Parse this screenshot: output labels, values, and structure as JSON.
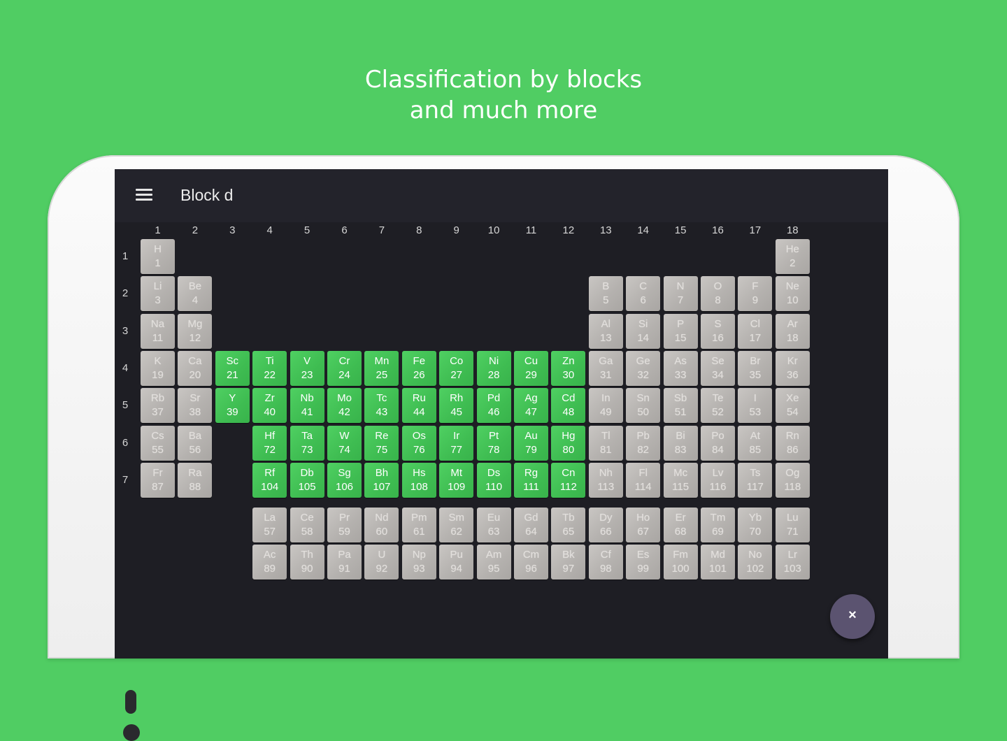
{
  "headline": {
    "line1": "Classification by blocks",
    "line2": "and much more"
  },
  "app": {
    "title": "Block d",
    "menu_icon": "hamburger-menu-icon",
    "fab_icon": "close-icon",
    "fab_symbol": "×"
  },
  "colors": {
    "background": "#50cd63",
    "screen": "#1e1e24",
    "toolbar": "#23232b",
    "block_d": "#42c155",
    "other": "#b9b6b3",
    "fab": "#5b5370"
  },
  "groups": [
    "1",
    "2",
    "3",
    "4",
    "5",
    "6",
    "7",
    "8",
    "9",
    "10",
    "11",
    "12",
    "13",
    "14",
    "15",
    "16",
    "17",
    "18"
  ],
  "periods": [
    "1",
    "2",
    "3",
    "4",
    "5",
    "6",
    "7"
  ],
  "elements": [
    {
      "sym": "H",
      "num": "1",
      "row": 1,
      "col": 1,
      "block": "s"
    },
    {
      "sym": "He",
      "num": "2",
      "row": 1,
      "col": 18,
      "block": "s"
    },
    {
      "sym": "Li",
      "num": "3",
      "row": 2,
      "col": 1,
      "block": "s"
    },
    {
      "sym": "Be",
      "num": "4",
      "row": 2,
      "col": 2,
      "block": "s"
    },
    {
      "sym": "B",
      "num": "5",
      "row": 2,
      "col": 13,
      "block": "p"
    },
    {
      "sym": "C",
      "num": "6",
      "row": 2,
      "col": 14,
      "block": "p"
    },
    {
      "sym": "N",
      "num": "7",
      "row": 2,
      "col": 15,
      "block": "p"
    },
    {
      "sym": "O",
      "num": "8",
      "row": 2,
      "col": 16,
      "block": "p"
    },
    {
      "sym": "F",
      "num": "9",
      "row": 2,
      "col": 17,
      "block": "p"
    },
    {
      "sym": "Ne",
      "num": "10",
      "row": 2,
      "col": 18,
      "block": "p"
    },
    {
      "sym": "Na",
      "num": "11",
      "row": 3,
      "col": 1,
      "block": "s"
    },
    {
      "sym": "Mg",
      "num": "12",
      "row": 3,
      "col": 2,
      "block": "s"
    },
    {
      "sym": "Al",
      "num": "13",
      "row": 3,
      "col": 13,
      "block": "p"
    },
    {
      "sym": "Si",
      "num": "14",
      "row": 3,
      "col": 14,
      "block": "p"
    },
    {
      "sym": "P",
      "num": "15",
      "row": 3,
      "col": 15,
      "block": "p"
    },
    {
      "sym": "S",
      "num": "16",
      "row": 3,
      "col": 16,
      "block": "p"
    },
    {
      "sym": "Cl",
      "num": "17",
      "row": 3,
      "col": 17,
      "block": "p"
    },
    {
      "sym": "Ar",
      "num": "18",
      "row": 3,
      "col": 18,
      "block": "p"
    },
    {
      "sym": "K",
      "num": "19",
      "row": 4,
      "col": 1,
      "block": "s"
    },
    {
      "sym": "Ca",
      "num": "20",
      "row": 4,
      "col": 2,
      "block": "s"
    },
    {
      "sym": "Sc",
      "num": "21",
      "row": 4,
      "col": 3,
      "block": "d"
    },
    {
      "sym": "Ti",
      "num": "22",
      "row": 4,
      "col": 4,
      "block": "d"
    },
    {
      "sym": "V",
      "num": "23",
      "row": 4,
      "col": 5,
      "block": "d"
    },
    {
      "sym": "Cr",
      "num": "24",
      "row": 4,
      "col": 6,
      "block": "d"
    },
    {
      "sym": "Mn",
      "num": "25",
      "row": 4,
      "col": 7,
      "block": "d"
    },
    {
      "sym": "Fe",
      "num": "26",
      "row": 4,
      "col": 8,
      "block": "d"
    },
    {
      "sym": "Co",
      "num": "27",
      "row": 4,
      "col": 9,
      "block": "d"
    },
    {
      "sym": "Ni",
      "num": "28",
      "row": 4,
      "col": 10,
      "block": "d"
    },
    {
      "sym": "Cu",
      "num": "29",
      "row": 4,
      "col": 11,
      "block": "d"
    },
    {
      "sym": "Zn",
      "num": "30",
      "row": 4,
      "col": 12,
      "block": "d"
    },
    {
      "sym": "Ga",
      "num": "31",
      "row": 4,
      "col": 13,
      "block": "p"
    },
    {
      "sym": "Ge",
      "num": "32",
      "row": 4,
      "col": 14,
      "block": "p"
    },
    {
      "sym": "As",
      "num": "33",
      "row": 4,
      "col": 15,
      "block": "p"
    },
    {
      "sym": "Se",
      "num": "34",
      "row": 4,
      "col": 16,
      "block": "p"
    },
    {
      "sym": "Br",
      "num": "35",
      "row": 4,
      "col": 17,
      "block": "p"
    },
    {
      "sym": "Kr",
      "num": "36",
      "row": 4,
      "col": 18,
      "block": "p"
    },
    {
      "sym": "Rb",
      "num": "37",
      "row": 5,
      "col": 1,
      "block": "s"
    },
    {
      "sym": "Sr",
      "num": "38",
      "row": 5,
      "col": 2,
      "block": "s"
    },
    {
      "sym": "Y",
      "num": "39",
      "row": 5,
      "col": 3,
      "block": "d"
    },
    {
      "sym": "Zr",
      "num": "40",
      "row": 5,
      "col": 4,
      "block": "d"
    },
    {
      "sym": "Nb",
      "num": "41",
      "row": 5,
      "col": 5,
      "block": "d"
    },
    {
      "sym": "Mo",
      "num": "42",
      "row": 5,
      "col": 6,
      "block": "d"
    },
    {
      "sym": "Tc",
      "num": "43",
      "row": 5,
      "col": 7,
      "block": "d"
    },
    {
      "sym": "Ru",
      "num": "44",
      "row": 5,
      "col": 8,
      "block": "d"
    },
    {
      "sym": "Rh",
      "num": "45",
      "row": 5,
      "col": 9,
      "block": "d"
    },
    {
      "sym": "Pd",
      "num": "46",
      "row": 5,
      "col": 10,
      "block": "d"
    },
    {
      "sym": "Ag",
      "num": "47",
      "row": 5,
      "col": 11,
      "block": "d"
    },
    {
      "sym": "Cd",
      "num": "48",
      "row": 5,
      "col": 12,
      "block": "d"
    },
    {
      "sym": "In",
      "num": "49",
      "row": 5,
      "col": 13,
      "block": "p"
    },
    {
      "sym": "Sn",
      "num": "50",
      "row": 5,
      "col": 14,
      "block": "p"
    },
    {
      "sym": "Sb",
      "num": "51",
      "row": 5,
      "col": 15,
      "block": "p"
    },
    {
      "sym": "Te",
      "num": "52",
      "row": 5,
      "col": 16,
      "block": "p"
    },
    {
      "sym": "I",
      "num": "53",
      "row": 5,
      "col": 17,
      "block": "p"
    },
    {
      "sym": "Xe",
      "num": "54",
      "row": 5,
      "col": 18,
      "block": "p"
    },
    {
      "sym": "Cs",
      "num": "55",
      "row": 6,
      "col": 1,
      "block": "s"
    },
    {
      "sym": "Ba",
      "num": "56",
      "row": 6,
      "col": 2,
      "block": "s"
    },
    {
      "sym": "Hf",
      "num": "72",
      "row": 6,
      "col": 4,
      "block": "d"
    },
    {
      "sym": "Ta",
      "num": "73",
      "row": 6,
      "col": 5,
      "block": "d"
    },
    {
      "sym": "W",
      "num": "74",
      "row": 6,
      "col": 6,
      "block": "d"
    },
    {
      "sym": "Re",
      "num": "75",
      "row": 6,
      "col": 7,
      "block": "d"
    },
    {
      "sym": "Os",
      "num": "76",
      "row": 6,
      "col": 8,
      "block": "d"
    },
    {
      "sym": "Ir",
      "num": "77",
      "row": 6,
      "col": 9,
      "block": "d"
    },
    {
      "sym": "Pt",
      "num": "78",
      "row": 6,
      "col": 10,
      "block": "d"
    },
    {
      "sym": "Au",
      "num": "79",
      "row": 6,
      "col": 11,
      "block": "d"
    },
    {
      "sym": "Hg",
      "num": "80",
      "row": 6,
      "col": 12,
      "block": "d"
    },
    {
      "sym": "Tl",
      "num": "81",
      "row": 6,
      "col": 13,
      "block": "p"
    },
    {
      "sym": "Pb",
      "num": "82",
      "row": 6,
      "col": 14,
      "block": "p"
    },
    {
      "sym": "Bi",
      "num": "83",
      "row": 6,
      "col": 15,
      "block": "p"
    },
    {
      "sym": "Po",
      "num": "84",
      "row": 6,
      "col": 16,
      "block": "p"
    },
    {
      "sym": "At",
      "num": "85",
      "row": 6,
      "col": 17,
      "block": "p"
    },
    {
      "sym": "Rn",
      "num": "86",
      "row": 6,
      "col": 18,
      "block": "p"
    },
    {
      "sym": "Fr",
      "num": "87",
      "row": 7,
      "col": 1,
      "block": "s"
    },
    {
      "sym": "Ra",
      "num": "88",
      "row": 7,
      "col": 2,
      "block": "s"
    },
    {
      "sym": "Rf",
      "num": "104",
      "row": 7,
      "col": 4,
      "block": "d"
    },
    {
      "sym": "Db",
      "num": "105",
      "row": 7,
      "col": 5,
      "block": "d"
    },
    {
      "sym": "Sg",
      "num": "106",
      "row": 7,
      "col": 6,
      "block": "d"
    },
    {
      "sym": "Bh",
      "num": "107",
      "row": 7,
      "col": 7,
      "block": "d"
    },
    {
      "sym": "Hs",
      "num": "108",
      "row": 7,
      "col": 8,
      "block": "d"
    },
    {
      "sym": "Mt",
      "num": "109",
      "row": 7,
      "col": 9,
      "block": "d"
    },
    {
      "sym": "Ds",
      "num": "110",
      "row": 7,
      "col": 10,
      "block": "d"
    },
    {
      "sym": "Rg",
      "num": "111",
      "row": 7,
      "col": 11,
      "block": "d"
    },
    {
      "sym": "Cn",
      "num": "112",
      "row": 7,
      "col": 12,
      "block": "d"
    },
    {
      "sym": "Nh",
      "num": "113",
      "row": 7,
      "col": 13,
      "block": "p"
    },
    {
      "sym": "Fl",
      "num": "114",
      "row": 7,
      "col": 14,
      "block": "p"
    },
    {
      "sym": "Mc",
      "num": "115",
      "row": 7,
      "col": 15,
      "block": "p"
    },
    {
      "sym": "Lv",
      "num": "116",
      "row": 7,
      "col": 16,
      "block": "p"
    },
    {
      "sym": "Ts",
      "num": "117",
      "row": 7,
      "col": 17,
      "block": "p"
    },
    {
      "sym": "Og",
      "num": "118",
      "row": 7,
      "col": 18,
      "block": "p"
    },
    {
      "sym": "La",
      "num": "57",
      "row": 8,
      "col": 4,
      "block": "f"
    },
    {
      "sym": "Ce",
      "num": "58",
      "row": 8,
      "col": 5,
      "block": "f"
    },
    {
      "sym": "Pr",
      "num": "59",
      "row": 8,
      "col": 6,
      "block": "f"
    },
    {
      "sym": "Nd",
      "num": "60",
      "row": 8,
      "col": 7,
      "block": "f"
    },
    {
      "sym": "Pm",
      "num": "61",
      "row": 8,
      "col": 8,
      "block": "f"
    },
    {
      "sym": "Sm",
      "num": "62",
      "row": 8,
      "col": 9,
      "block": "f"
    },
    {
      "sym": "Eu",
      "num": "63",
      "row": 8,
      "col": 10,
      "block": "f"
    },
    {
      "sym": "Gd",
      "num": "64",
      "row": 8,
      "col": 11,
      "block": "f"
    },
    {
      "sym": "Tb",
      "num": "65",
      "row": 8,
      "col": 12,
      "block": "f"
    },
    {
      "sym": "Dy",
      "num": "66",
      "row": 8,
      "col": 13,
      "block": "f"
    },
    {
      "sym": "Ho",
      "num": "67",
      "row": 8,
      "col": 14,
      "block": "f"
    },
    {
      "sym": "Er",
      "num": "68",
      "row": 8,
      "col": 15,
      "block": "f"
    },
    {
      "sym": "Tm",
      "num": "69",
      "row": 8,
      "col": 16,
      "block": "f"
    },
    {
      "sym": "Yb",
      "num": "70",
      "row": 8,
      "col": 17,
      "block": "f"
    },
    {
      "sym": "Lu",
      "num": "71",
      "row": 8,
      "col": 18,
      "block": "f"
    },
    {
      "sym": "Ac",
      "num": "89",
      "row": 9,
      "col": 4,
      "block": "f"
    },
    {
      "sym": "Th",
      "num": "90",
      "row": 9,
      "col": 5,
      "block": "f"
    },
    {
      "sym": "Pa",
      "num": "91",
      "row": 9,
      "col": 6,
      "block": "f"
    },
    {
      "sym": "U",
      "num": "92",
      "row": 9,
      "col": 7,
      "block": "f"
    },
    {
      "sym": "Np",
      "num": "93",
      "row": 9,
      "col": 8,
      "block": "f"
    },
    {
      "sym": "Pu",
      "num": "94",
      "row": 9,
      "col": 9,
      "block": "f"
    },
    {
      "sym": "Am",
      "num": "95",
      "row": 9,
      "col": 10,
      "block": "f"
    },
    {
      "sym": "Cm",
      "num": "96",
      "row": 9,
      "col": 11,
      "block": "f"
    },
    {
      "sym": "Bk",
      "num": "97",
      "row": 9,
      "col": 12,
      "block": "f"
    },
    {
      "sym": "Cf",
      "num": "98",
      "row": 9,
      "col": 13,
      "block": "f"
    },
    {
      "sym": "Es",
      "num": "99",
      "row": 9,
      "col": 14,
      "block": "f"
    },
    {
      "sym": "Fm",
      "num": "100",
      "row": 9,
      "col": 15,
      "block": "f"
    },
    {
      "sym": "Md",
      "num": "101",
      "row": 9,
      "col": 16,
      "block": "f"
    },
    {
      "sym": "No",
      "num": "102",
      "row": 9,
      "col": 17,
      "block": "f"
    },
    {
      "sym": "Lr",
      "num": "103",
      "row": 9,
      "col": 18,
      "block": "f"
    }
  ]
}
